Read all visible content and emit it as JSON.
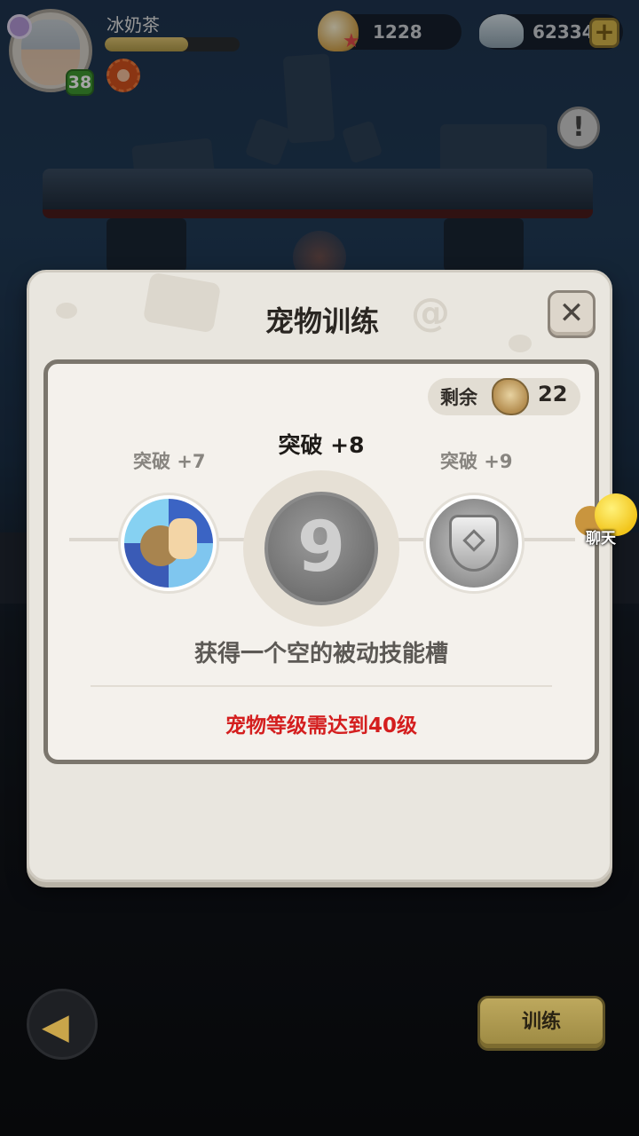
{
  "player": {
    "name": "冰奶茶",
    "level": "38",
    "xp_fraction": 0.62
  },
  "currencies": {
    "pearl": "1228",
    "shell": "62334",
    "add_symbol": "+"
  },
  "hud": {
    "alert_symbol": "!"
  },
  "modal": {
    "title": "宠物训练",
    "close_symbol": "✕",
    "remaining_label": "剩余",
    "remaining_count": "22",
    "stages": {
      "previous": "突破 +7",
      "current": "突破 +8",
      "next": "突破 +9"
    },
    "current_orb_glyph": "9",
    "skill_description": "获得一个空的被动技能槽",
    "requirement": "宠物等级需达到40级"
  },
  "chat": {
    "label": "聊天"
  },
  "footer": {
    "train_label": "训练"
  },
  "colors": {
    "requirement_text": "#d41e1e",
    "train_button": "#bda85d",
    "level_badge": "#3f9a32"
  },
  "icons": [
    "avatar",
    "emblem-icon",
    "pearl-icon",
    "starfish-icon",
    "shell-icon",
    "plus-icon",
    "alert-icon",
    "close-icon",
    "fossil-icon",
    "fist-skill-icon",
    "swirl-skill-icon",
    "shield-skill-icon",
    "chat-icon",
    "back-arrow-icon"
  ]
}
